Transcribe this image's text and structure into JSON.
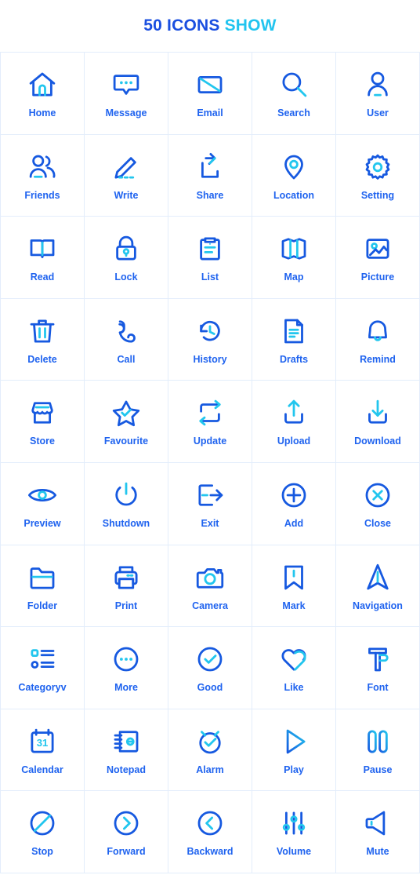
{
  "header": {
    "title_main": "50 ICONS",
    "title_accent": "SHOW"
  },
  "colors": {
    "primary": "#1659e0",
    "accent": "#22c6ee",
    "label": "#1f63ef",
    "grid_line": "#e3edfb",
    "background": "#ffffff"
  },
  "grid": {
    "columns": 5,
    "rows": 10,
    "total_icons": 50
  },
  "icons": [
    {
      "id": "home",
      "label": "Home",
      "icon": "home-icon"
    },
    {
      "id": "message",
      "label": "Message",
      "icon": "message-icon"
    },
    {
      "id": "email",
      "label": "Email",
      "icon": "email-icon"
    },
    {
      "id": "search",
      "label": "Search",
      "icon": "search-icon"
    },
    {
      "id": "user",
      "label": "User",
      "icon": "user-icon"
    },
    {
      "id": "friends",
      "label": "Friends",
      "icon": "friends-icon"
    },
    {
      "id": "write",
      "label": "Write",
      "icon": "write-icon"
    },
    {
      "id": "share",
      "label": "Share",
      "icon": "share-icon"
    },
    {
      "id": "location",
      "label": "Location",
      "icon": "location-icon"
    },
    {
      "id": "setting",
      "label": "Setting",
      "icon": "setting-icon"
    },
    {
      "id": "read",
      "label": "Read",
      "icon": "book-icon"
    },
    {
      "id": "lock",
      "label": "Lock",
      "icon": "lock-icon"
    },
    {
      "id": "list",
      "label": "List",
      "icon": "clipboard-icon"
    },
    {
      "id": "map",
      "label": "Map",
      "icon": "map-icon"
    },
    {
      "id": "picture",
      "label": "Picture",
      "icon": "picture-icon"
    },
    {
      "id": "delete",
      "label": "Delete",
      "icon": "trash-icon"
    },
    {
      "id": "call",
      "label": "Call",
      "icon": "phone-icon"
    },
    {
      "id": "history",
      "label": "History",
      "icon": "history-icon"
    },
    {
      "id": "drafts",
      "label": "Drafts",
      "icon": "document-icon"
    },
    {
      "id": "remind",
      "label": "Remind",
      "icon": "bell-icon"
    },
    {
      "id": "store",
      "label": "Store",
      "icon": "store-icon"
    },
    {
      "id": "favourite",
      "label": "Favourite",
      "icon": "star-icon"
    },
    {
      "id": "update",
      "label": "Update",
      "icon": "refresh-icon"
    },
    {
      "id": "upload",
      "label": "Upload",
      "icon": "upload-icon"
    },
    {
      "id": "download",
      "label": "Download",
      "icon": "download-icon"
    },
    {
      "id": "preview",
      "label": "Preview",
      "icon": "eye-icon"
    },
    {
      "id": "shutdown",
      "label": "Shutdown",
      "icon": "power-icon"
    },
    {
      "id": "exit",
      "label": "Exit",
      "icon": "exit-icon"
    },
    {
      "id": "add",
      "label": "Add",
      "icon": "plus-circle-icon"
    },
    {
      "id": "close",
      "label": "Close",
      "icon": "close-circle-icon"
    },
    {
      "id": "folder",
      "label": "Folder",
      "icon": "folder-icon"
    },
    {
      "id": "print",
      "label": "Print",
      "icon": "printer-icon"
    },
    {
      "id": "camera",
      "label": "Camera",
      "icon": "camera-icon"
    },
    {
      "id": "mark",
      "label": "Mark",
      "icon": "bookmark-icon"
    },
    {
      "id": "navigation",
      "label": "Navigation",
      "icon": "navigation-icon"
    },
    {
      "id": "category",
      "label": "Categoryv",
      "icon": "category-list-icon"
    },
    {
      "id": "more",
      "label": "More",
      "icon": "more-circle-icon"
    },
    {
      "id": "good",
      "label": "Good",
      "icon": "check-circle-icon"
    },
    {
      "id": "like",
      "label": "Like",
      "icon": "heart-icon"
    },
    {
      "id": "font",
      "label": "Font",
      "icon": "font-icon"
    },
    {
      "id": "calendar",
      "label": "Calendar",
      "icon": "calendar-icon",
      "day": "31"
    },
    {
      "id": "notepad",
      "label": "Notepad",
      "icon": "notepad-icon"
    },
    {
      "id": "alarm",
      "label": "Alarm",
      "icon": "alarm-icon"
    },
    {
      "id": "play",
      "label": "Play",
      "icon": "play-icon"
    },
    {
      "id": "pause",
      "label": "Pause",
      "icon": "pause-icon"
    },
    {
      "id": "stop",
      "label": "Stop",
      "icon": "stop-icon"
    },
    {
      "id": "forward",
      "label": "Forward",
      "icon": "chevron-right-circle-icon"
    },
    {
      "id": "backward",
      "label": "Backward",
      "icon": "chevron-left-circle-icon"
    },
    {
      "id": "volume",
      "label": "Volume",
      "icon": "sliders-icon"
    },
    {
      "id": "mute",
      "label": "Mute",
      "icon": "mute-icon"
    }
  ]
}
